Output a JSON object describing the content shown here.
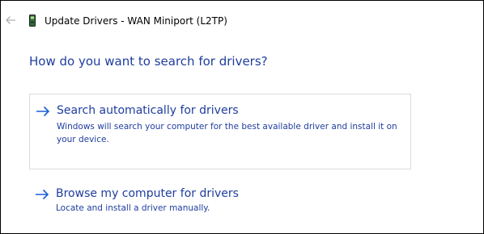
{
  "window": {
    "title": "Update Drivers - WAN Miniport (L2TP)"
  },
  "icons": {
    "back": "back-arrow-icon",
    "device": "device-icon",
    "option_arrow": "right-arrow-icon"
  },
  "colors": {
    "link": "#1f3d9e",
    "card_border": "#dcdcdc",
    "arrow": "#1a5fd6"
  },
  "main": {
    "heading": "How do you want to search for drivers?",
    "options": [
      {
        "title": "Search automatically for drivers",
        "description": "Windows will search your computer for the best available driver and install it on your device."
      },
      {
        "title": "Browse my computer for drivers",
        "description": "Locate and install a driver manually."
      }
    ]
  }
}
